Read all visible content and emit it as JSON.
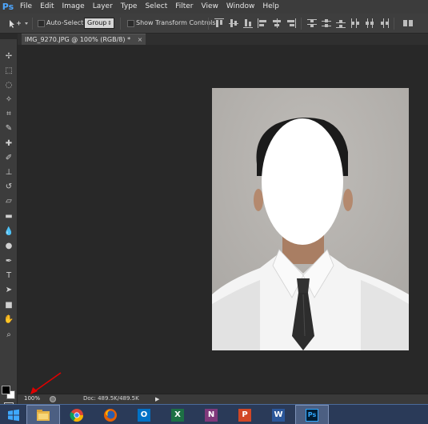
{
  "menubar": {
    "logo": "Ps",
    "items": [
      "File",
      "Edit",
      "Image",
      "Layer",
      "Type",
      "Select",
      "Filter",
      "View",
      "Window",
      "Help"
    ]
  },
  "options": {
    "auto_select_label": "Auto-Select:",
    "auto_select_value": "Group",
    "show_transform_label": "Show Transform Controls"
  },
  "document": {
    "tab_title": "IMG_9270.JPG @ 100% (RGB/8) *",
    "close_glyph": "×"
  },
  "status": {
    "zoom": "100%",
    "doc_info": "Doc: 489.5K/489.5K",
    "arrow_glyph": "▶"
  },
  "tools": [
    {
      "icon": "move-tool-icon",
      "glyph": "✢"
    },
    {
      "icon": "marquee-tool-icon",
      "glyph": "⬚"
    },
    {
      "icon": "lasso-tool-icon",
      "glyph": "◌"
    },
    {
      "icon": "magic-wand-tool-icon",
      "glyph": "✧"
    },
    {
      "icon": "crop-tool-icon",
      "glyph": "⌗"
    },
    {
      "icon": "eyedropper-tool-icon",
      "glyph": "✎"
    },
    {
      "icon": "healing-brush-tool-icon",
      "glyph": "✚"
    },
    {
      "icon": "brush-tool-icon",
      "glyph": "✐"
    },
    {
      "icon": "clone-stamp-tool-icon",
      "glyph": "⊥"
    },
    {
      "icon": "history-brush-tool-icon",
      "glyph": "↺"
    },
    {
      "icon": "eraser-tool-icon",
      "glyph": "▱"
    },
    {
      "icon": "gradient-tool-icon",
      "glyph": "▬"
    },
    {
      "icon": "blur-tool-icon",
      "glyph": "💧"
    },
    {
      "icon": "dodge-tool-icon",
      "glyph": "●"
    },
    {
      "icon": "pen-tool-icon",
      "glyph": "✒"
    },
    {
      "icon": "type-tool-icon",
      "glyph": "T"
    },
    {
      "icon": "path-selection-tool-icon",
      "glyph": "➤"
    },
    {
      "icon": "rectangle-tool-icon",
      "glyph": "■"
    },
    {
      "icon": "hand-tool-icon",
      "glyph": "✋"
    },
    {
      "icon": "zoom-tool-icon",
      "glyph": "⌕"
    }
  ],
  "colors": {
    "foreground": "#000000",
    "background": "#ffffff",
    "annotation_arrow": "#e00000"
  },
  "taskbar": {
    "apps": [
      {
        "name": "windows-start-icon",
        "label": ""
      },
      {
        "name": "file-explorer-icon",
        "label": ""
      },
      {
        "name": "chrome-icon",
        "label": ""
      },
      {
        "name": "firefox-icon",
        "label": ""
      },
      {
        "name": "outlook-icon",
        "label": "O"
      },
      {
        "name": "excel-icon",
        "label": "X"
      },
      {
        "name": "onenote-icon",
        "label": "N"
      },
      {
        "name": "powerpoint-icon",
        "label": "P"
      },
      {
        "name": "word-icon",
        "label": "W"
      },
      {
        "name": "photoshop-icon",
        "label": "Ps"
      }
    ]
  }
}
